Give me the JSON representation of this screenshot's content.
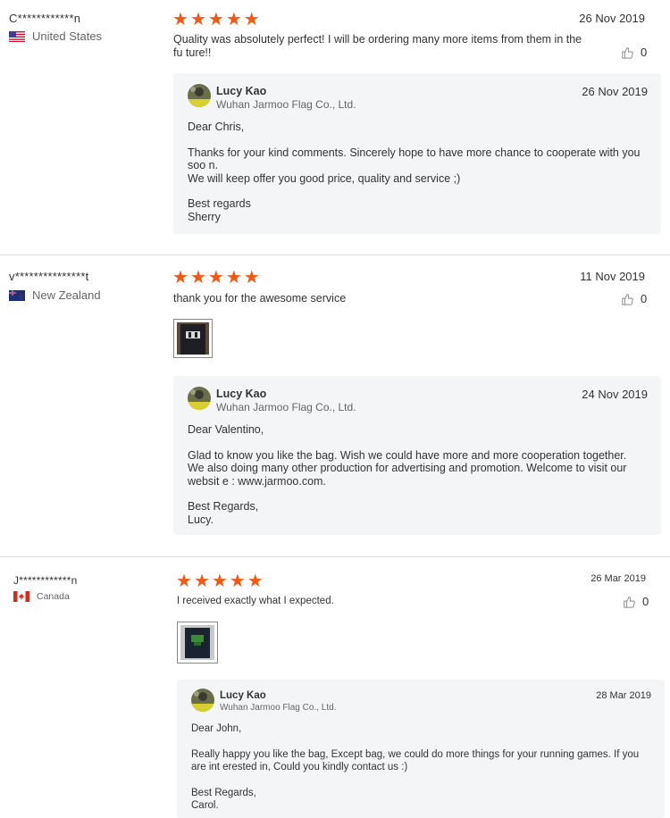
{
  "reviews": [
    {
      "username": "C************n",
      "country": "United States",
      "stars": 5,
      "text": "Quality was absolutely perfect! I will be ordering many more items from them in the fu ture!!",
      "date": "26 Nov 2019",
      "likes": "0",
      "reply": {
        "seller_name": "Lucy Kao",
        "company": "Wuhan Jarmoo Flag Co., Ltd.",
        "date": "26 Nov 2019",
        "greeting": "Dear Chris,",
        "body": [
          "Thanks for your kind comments.  Sincerely hope to have more chance to cooperate with you soo n.",
          "We will keep offer you good price, quality and service ;)"
        ],
        "closing": [
          "Best regards",
          "Sherry"
        ]
      }
    },
    {
      "username": "v***************t",
      "country": "New Zealand",
      "stars": 5,
      "text": "thank you for the awesome service",
      "date": "11 Nov 2019",
      "likes": "0",
      "reply": {
        "seller_name": "Lucy Kao",
        "company": "Wuhan Jarmoo Flag Co., Ltd.",
        "date": "24 Nov 2019",
        "greeting": "Dear Valentino,",
        "body": [
          "Glad to know you like the bag. Wish we could have more and more cooperation together.",
          "We also doing many other production for advertising and promotion. Welcome to visit our websit e : www.jarmoo.com."
        ],
        "closing": [
          "Best Regards,",
          "Lucy."
        ]
      }
    },
    {
      "username": "J************n",
      "country": "Canada",
      "stars": 5,
      "text": "I received exactly what I expected.",
      "date": "26 Mar 2019",
      "likes": "0",
      "reply": {
        "seller_name": "Lucy Kao",
        "company": "Wuhan Jarmoo Flag Co., Ltd.",
        "date": "28 Mar 2019",
        "greeting": "Dear John,",
        "body": [
          "Really happy you like the bag,  Except bag, we could do more things for your running games. If you are int erested in, Could you kindly contact us :)"
        ],
        "closing": [
          "Best Regards,",
          "Carol."
        ]
      }
    }
  ],
  "colors": {
    "star": "#f05a14",
    "reply_bg": "#f4f5f7",
    "divider": "#dddddd"
  },
  "icons": {
    "star": "star-icon",
    "like": "thumbs-up-icon"
  }
}
